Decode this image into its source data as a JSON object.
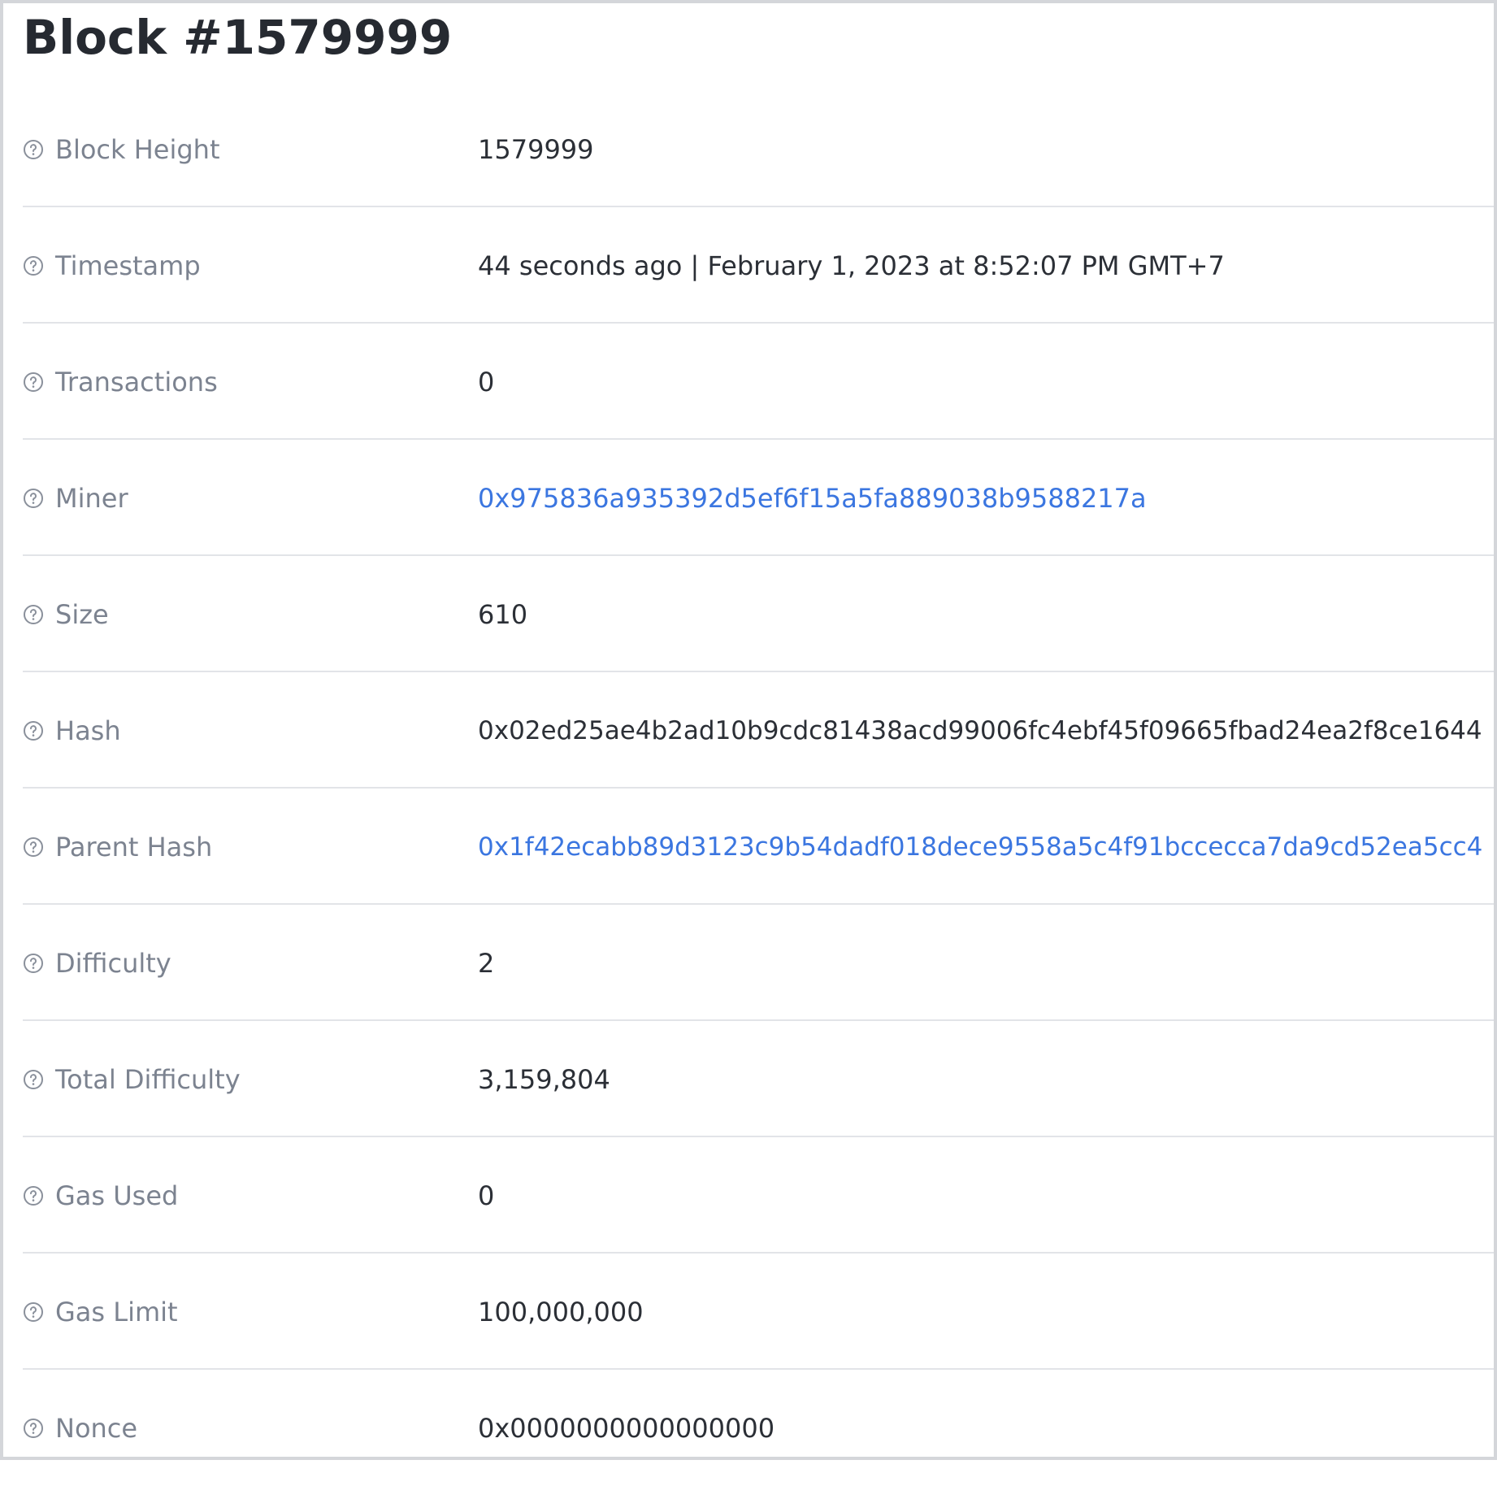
{
  "page": {
    "title": "Block #1579999"
  },
  "rows": [
    {
      "label": "Block Height",
      "value": "1579999",
      "is_link": false
    },
    {
      "label": "Timestamp",
      "value": "44 seconds ago | February 1, 2023 at 8:52:07 PM GMT+7",
      "is_link": false
    },
    {
      "label": "Transactions",
      "value": "0",
      "is_link": false
    },
    {
      "label": "Miner",
      "value": "0x975836a935392d5ef6f15a5fa889038b9588217a",
      "is_link": true
    },
    {
      "label": "Size",
      "value": "610",
      "is_link": false
    },
    {
      "label": "Hash",
      "value": "0x02ed25ae4b2ad10b9cdc81438acd99006fc4ebf45f09665fbad24ea2f8ce1644",
      "is_link": false
    },
    {
      "label": "Parent Hash",
      "value": "0x1f42ecabb89d3123c9b54dadf018dece9558a5c4f91bccecca7da9cd52ea5cc4",
      "is_link": true
    },
    {
      "label": "Difficulty",
      "value": "2",
      "is_link": false
    },
    {
      "label": "Total Difficulty",
      "value": "3,159,804",
      "is_link": false
    },
    {
      "label": "Gas Used",
      "value": "0",
      "is_link": false
    },
    {
      "label": "Gas Limit",
      "value": "100,000,000",
      "is_link": false
    },
    {
      "label": "Nonce",
      "value": "0x0000000000000000",
      "is_link": false
    }
  ],
  "colors": {
    "link": "#3b76e0",
    "label": "#7c8390",
    "value": "#2b2f36",
    "divider": "#e2e4e8"
  },
  "icons": {
    "row_icon": "help-circle-icon"
  }
}
